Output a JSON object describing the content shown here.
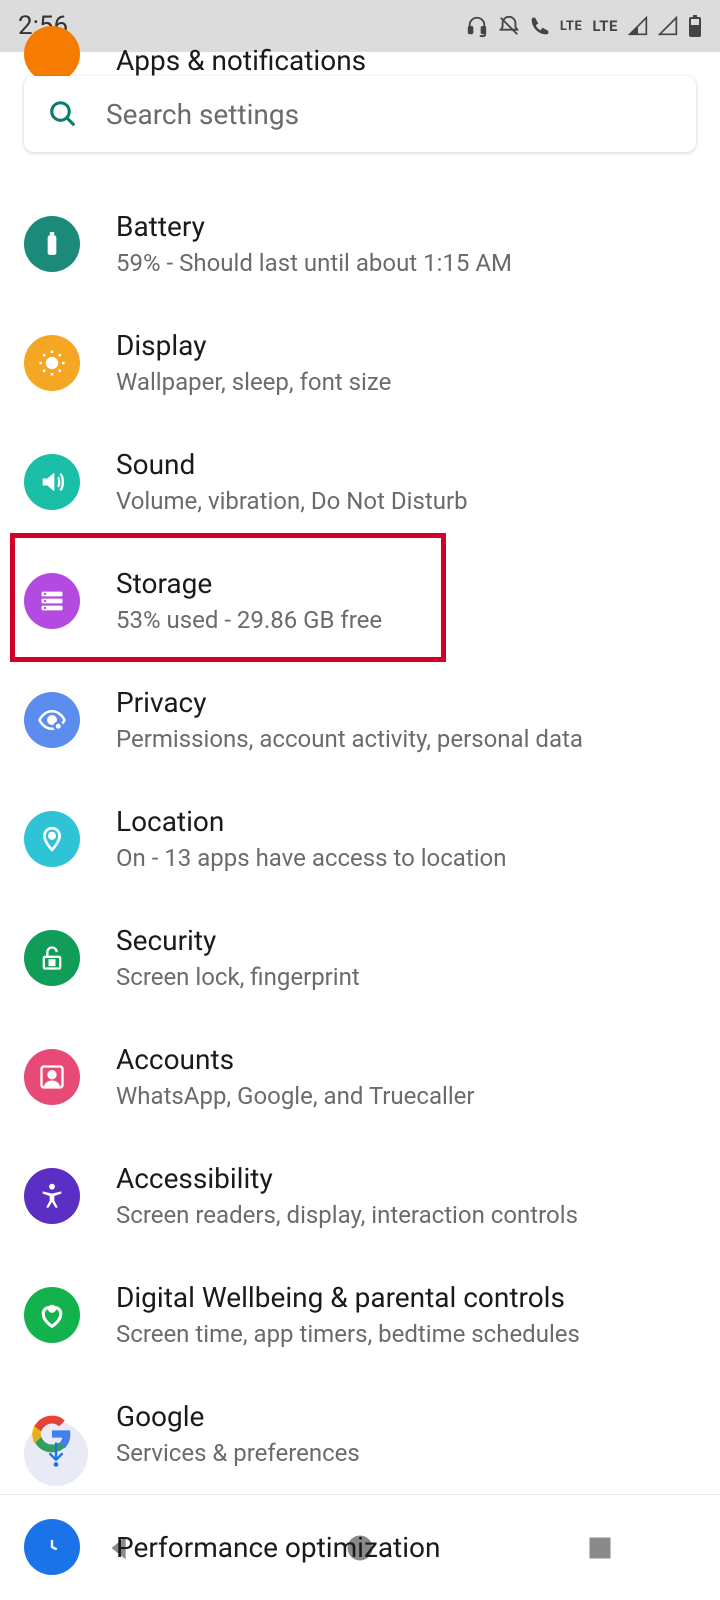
{
  "statusbar": {
    "time": "2:56",
    "network_label": "LTE"
  },
  "search": {
    "placeholder": "Search settings"
  },
  "partial": {
    "title": "Apps & notifications",
    "icon_color": "#f57c00"
  },
  "items": [
    {
      "id": "battery",
      "title": "Battery",
      "sub": "59% - Should last until about 1:15 AM",
      "color": "#1b8a7a"
    },
    {
      "id": "display",
      "title": "Display",
      "sub": "Wallpaper, sleep, font size",
      "color": "#f5a623"
    },
    {
      "id": "sound",
      "title": "Sound",
      "sub": "Volume, vibration, Do Not Disturb",
      "color": "#1bbfa7"
    },
    {
      "id": "storage",
      "title": "Storage",
      "sub": "53% used - 29.86 GB free",
      "color": "#b34be0"
    },
    {
      "id": "privacy",
      "title": "Privacy",
      "sub": "Permissions, account activity, personal data",
      "color": "#5b8def"
    },
    {
      "id": "location",
      "title": "Location",
      "sub": "On - 13 apps have access to location",
      "color": "#2ec4d6"
    },
    {
      "id": "security",
      "title": "Security",
      "sub": "Screen lock, fingerprint",
      "color": "#0f9d58"
    },
    {
      "id": "accounts",
      "title": "Accounts",
      "sub": "WhatsApp, Google, and Truecaller",
      "color": "#e84a78"
    },
    {
      "id": "accessibility",
      "title": "Accessibility",
      "sub": "Screen readers, display, interaction controls",
      "color": "#5b2ec4"
    },
    {
      "id": "wellbeing",
      "title": "Digital Wellbeing & parental controls",
      "sub": "Screen time, app timers, bedtime schedules",
      "color": "#14b24c"
    },
    {
      "id": "google",
      "title": "Google",
      "sub": "Services & preferences",
      "color": "#ffffff"
    },
    {
      "id": "performance",
      "title": "Performance optimization",
      "sub": "",
      "color": "#1a73e8"
    }
  ],
  "highlight_index": 3
}
